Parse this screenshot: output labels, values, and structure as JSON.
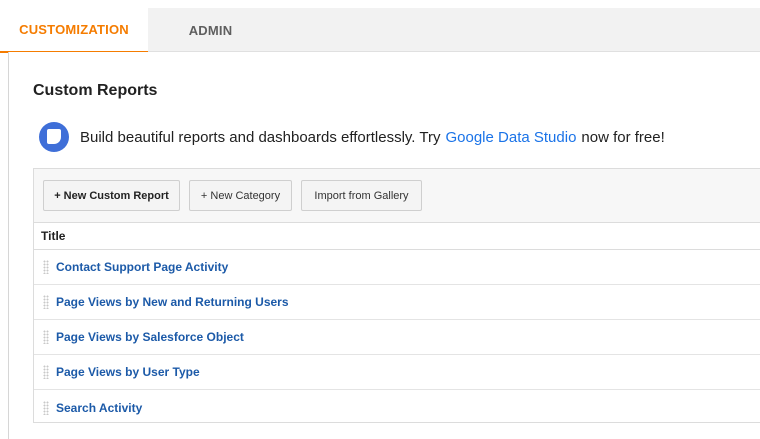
{
  "tabs": {
    "customization": "CUSTOMIZATION",
    "admin": "ADMIN"
  },
  "colors": {
    "active_tab": "#f57c00",
    "link": "#1c5aa8",
    "promo_link": "#1a73e8",
    "data_studio_icon": "#3f6fd8"
  },
  "page": {
    "title": "Custom Reports"
  },
  "promo": {
    "icon": "google-data-studio-icon",
    "text_before": "Build beautiful reports and dashboards effortlessly. Try",
    "link_text": "Google Data Studio",
    "text_after": "now for free!"
  },
  "toolbar": {
    "new_custom_report": "+ New Custom Report",
    "new_category": "+ New Category",
    "import_from_gallery": "Import from Gallery"
  },
  "table": {
    "column_title": "Title",
    "rows": [
      "Contact Support Page Activity",
      "Page Views by New and Returning Users",
      "Page Views by Salesforce Object",
      "Page Views by User Type",
      "Search Activity"
    ]
  }
}
